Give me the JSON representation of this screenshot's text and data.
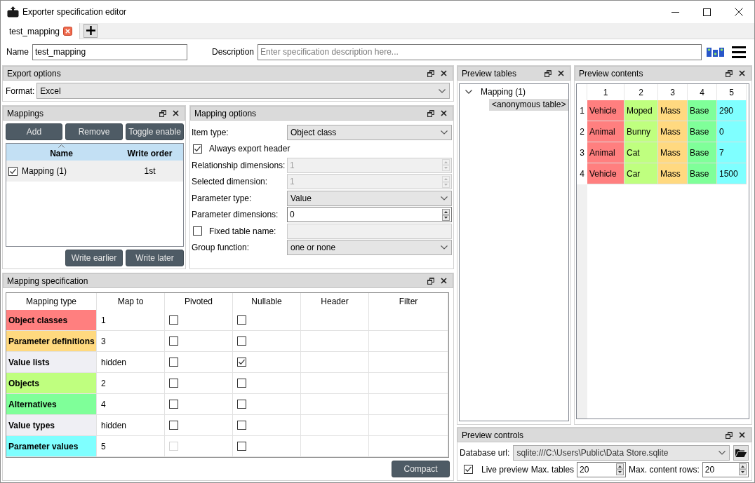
{
  "window": {
    "title": "Exporter specification editor"
  },
  "tabs": [
    {
      "label": "test_mapping",
      "selected": true
    }
  ],
  "specification": {
    "name_label": "Name",
    "name": "test_mapping",
    "description_label": "Description",
    "description_placeholder": "Enter specification description here..."
  },
  "export_options": {
    "title": "Export options",
    "format_label": "Format:",
    "format": "Excel"
  },
  "mappings": {
    "title": "Mappings",
    "buttons": [
      "Add",
      "Remove",
      "Toggle enable"
    ],
    "columns": [
      "Name",
      "Write order"
    ],
    "rows": [
      {
        "name": "Mapping (1)",
        "checked": true,
        "write_order": "1st",
        "selected": true
      }
    ],
    "order_buttons": [
      "Write earlier",
      "Write later"
    ]
  },
  "mapping_options": {
    "title": "Mapping options",
    "fields": [
      {
        "kind": "combo",
        "label": "Item type:",
        "value": "Object class"
      },
      {
        "kind": "checkbox",
        "label": "Always export header",
        "checked": true
      },
      {
        "kind": "spin",
        "label": "Relationship dimensions:",
        "value": "1",
        "disabled": true
      },
      {
        "kind": "spin",
        "label": "Selected dimension:",
        "value": "1",
        "disabled": true
      },
      {
        "kind": "combo",
        "label": "Parameter type:",
        "value": "Value"
      },
      {
        "kind": "spin",
        "label": "Parameter dimensions:",
        "value": "0",
        "disabled": false
      },
      {
        "kind": "checkbox_field",
        "label": "Fixed table name:",
        "checked": false,
        "disabled": true
      },
      {
        "kind": "combo",
        "label": "Group function:",
        "value": "one or none"
      }
    ]
  },
  "mapping_specification": {
    "title": "Mapping specification",
    "columns": [
      "Mapping type",
      "Map to",
      "Pivoted",
      "Nullable",
      "Header",
      "Filter"
    ],
    "rows": [
      {
        "mapping_type": "Object classes",
        "color": "#ff7f7f",
        "map_to": "1",
        "pivoted": {
          "checked": false,
          "disabled": false
        },
        "nullable": false
      },
      {
        "mapping_type": "Parameter definitions",
        "color": "#ffd97f",
        "map_to": "3",
        "pivoted": {
          "checked": false,
          "disabled": false
        },
        "nullable": false
      },
      {
        "mapping_type": "Value lists",
        "color": "#efeff4",
        "map_to": "hidden",
        "pivoted": {
          "checked": false,
          "disabled": false
        },
        "nullable": true
      },
      {
        "mapping_type": "Objects",
        "color": "#bfff7f",
        "map_to": "2",
        "pivoted": {
          "checked": false,
          "disabled": false
        },
        "nullable": false
      },
      {
        "mapping_type": "Alternatives",
        "color": "#7fff99",
        "map_to": "4",
        "pivoted": {
          "checked": false,
          "disabled": false
        },
        "nullable": false
      },
      {
        "mapping_type": "Value types",
        "color": "#efeff4",
        "map_to": "hidden",
        "pivoted": {
          "checked": false,
          "disabled": false
        },
        "nullable": false
      },
      {
        "mapping_type": "Parameter values",
        "color": "#7fffff",
        "map_to": "5",
        "pivoted": {
          "checked": false,
          "disabled": true
        },
        "nullable": false
      }
    ],
    "button": "Compact"
  },
  "preview_tables": {
    "title": "Preview tables",
    "tree": [
      {
        "label": "Mapping (1)",
        "expanded": true,
        "selected": false,
        "children": [
          {
            "label": "<anonymous table>",
            "selected": true
          }
        ]
      }
    ]
  },
  "preview_contents": {
    "title": "Preview contents",
    "columns": [
      "1",
      "2",
      "3",
      "4",
      "5"
    ],
    "rows": [
      {
        "header": "1",
        "cells": [
          {
            "text": "Vehicle",
            "color": "#ff7f7f"
          },
          {
            "text": "Moped",
            "color": "#bfff7f"
          },
          {
            "text": "Mass",
            "color": "#ffd980"
          },
          {
            "text": "Base",
            "color": "#7fff99"
          },
          {
            "text": "290",
            "color": "#7fffff"
          }
        ]
      },
      {
        "header": "2",
        "cells": [
          {
            "text": "Animal",
            "color": "#ff7f7f"
          },
          {
            "text": "Bunny",
            "color": "#bfff7f"
          },
          {
            "text": "Mass",
            "color": "#ffd980"
          },
          {
            "text": "Base",
            "color": "#7fff99"
          },
          {
            "text": "0",
            "color": "#7fffff"
          }
        ]
      },
      {
        "header": "3",
        "cells": [
          {
            "text": "Animal",
            "color": "#ff7f7f"
          },
          {
            "text": "Cat",
            "color": "#bfff7f"
          },
          {
            "text": "Mass",
            "color": "#ffd980"
          },
          {
            "text": "Base",
            "color": "#7fff99"
          },
          {
            "text": "7",
            "color": "#7fffff"
          }
        ]
      },
      {
        "header": "4",
        "cells": [
          {
            "text": "Vehicle",
            "color": "#ff7f7f"
          },
          {
            "text": "Car",
            "color": "#bfff7f"
          },
          {
            "text": "Mass",
            "color": "#ffd980"
          },
          {
            "text": "Base",
            "color": "#7fff99"
          },
          {
            "text": "1500",
            "color": "#7fffff"
          }
        ]
      }
    ]
  },
  "preview_controls": {
    "title": "Preview controls",
    "database_url_label": "Database url:",
    "database_url": "sqlite:///C:\\Users\\Public\\Data Store.sqlite",
    "live_preview": {
      "label": "Live preview",
      "checked": true
    },
    "max_tables_label": "Max. tables",
    "max_tables": "20",
    "max_content_rows_label": "Max. content rows:",
    "max_content_rows": "20"
  }
}
